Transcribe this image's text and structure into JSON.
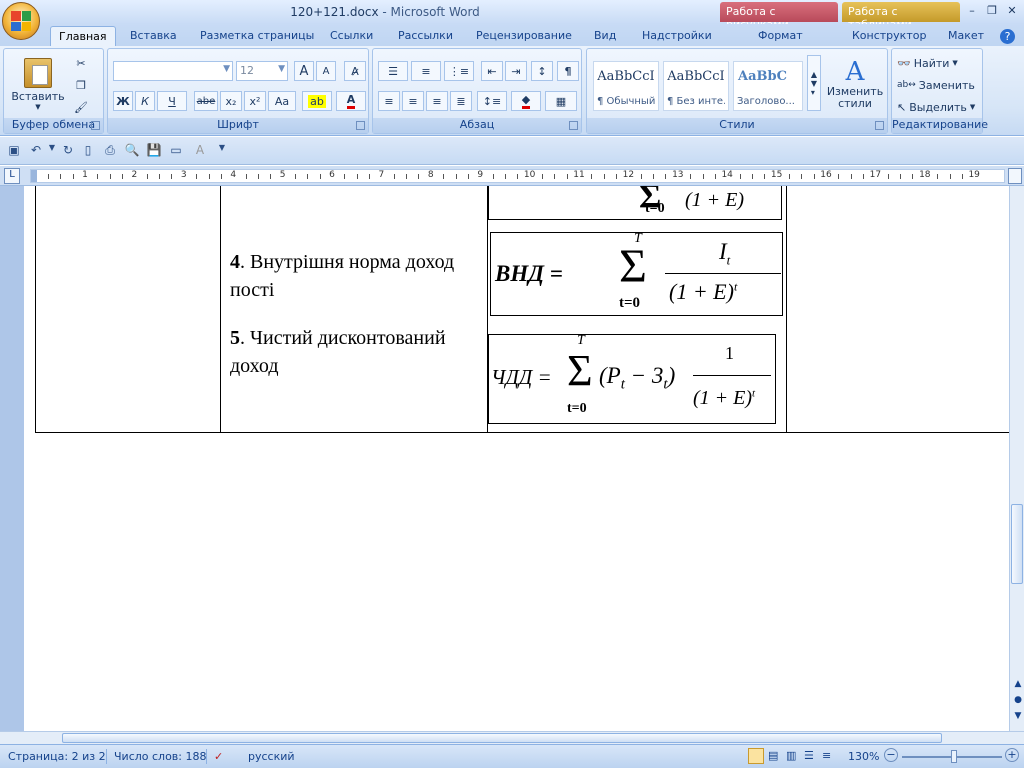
{
  "window": {
    "doc_name": "120+121.docx",
    "app_name": "- Microsoft Word",
    "minimize": "–",
    "restore": "❐",
    "close": "✕"
  },
  "context_tabs": {
    "pictures": "Работа с рисунками",
    "tables": "Работа с таблицами"
  },
  "tabs": [
    "Главная",
    "Вставка",
    "Разметка страницы",
    "Ссылки",
    "Рассылки",
    "Рецензирование",
    "Вид",
    "Надстройки",
    "Формат",
    "Конструктор",
    "Макет"
  ],
  "ribbon": {
    "clipboard": {
      "label": "Буфер обмена",
      "paste": "Вставить"
    },
    "font": {
      "label": "Шрифт",
      "font_name": "",
      "font_size": "12",
      "bold": "Ж",
      "italic": "К",
      "underline": "Ч",
      "strike": "abe",
      "sub": "x₂",
      "sup": "x²",
      "case": "Aa",
      "grow": "A",
      "shrink": "A"
    },
    "paragraph": {
      "label": "Абзац",
      "pilcrow": "¶"
    },
    "styles": {
      "label": "Стили",
      "items": [
        {
          "sample": "AaBbCcI",
          "name": "¶ Обычный"
        },
        {
          "sample": "AaBbCcI",
          "name": "¶ Без инте..."
        },
        {
          "sample": "AaBbC",
          "name": "Заголово..."
        }
      ],
      "change": "Изменить стили"
    },
    "editing": {
      "label": "Редактирование",
      "find": "Найти",
      "replace": "Заменить",
      "select": "Выделить"
    }
  },
  "ruler": {
    "numbers": [
      "1",
      "2",
      "3",
      "4",
      "5",
      "6",
      "7",
      "8",
      "9",
      "10",
      "11",
      "12",
      "13",
      "14",
      "15",
      "16",
      "17",
      "18",
      "19"
    ]
  },
  "document": {
    "item4_num": "4",
    "item4_text": ". Внутрішня норма доход пості",
    "item5_num": "5",
    "item5_text": ". Чистий дисконтований доход",
    "formula_top": {
      "lower": "t=0",
      "frac": "(1 + E)"
    },
    "formula_vnd": {
      "lhs": "ВНД =",
      "sigma": "Σ",
      "upper": "T",
      "lower": "t=0",
      "numer": "I",
      "numer_sub": "t",
      "denom": "(1 + E)",
      "denom_sup": "t"
    },
    "formula_chdd": {
      "lhs": "ЧДД =",
      "sigma": "Σ",
      "upper": "T",
      "lower": "t=0",
      "body": "(P",
      "sub1": "t",
      "minus": " − 3",
      "sub2": "t",
      "close": ")",
      "numer": "1",
      "denom": "(1 + E)",
      "denom_sup": "t"
    }
  },
  "status": {
    "page": "Страница: 2 из 2",
    "words": "Число слов: 188",
    "lang": "русский",
    "zoom": "130%"
  }
}
